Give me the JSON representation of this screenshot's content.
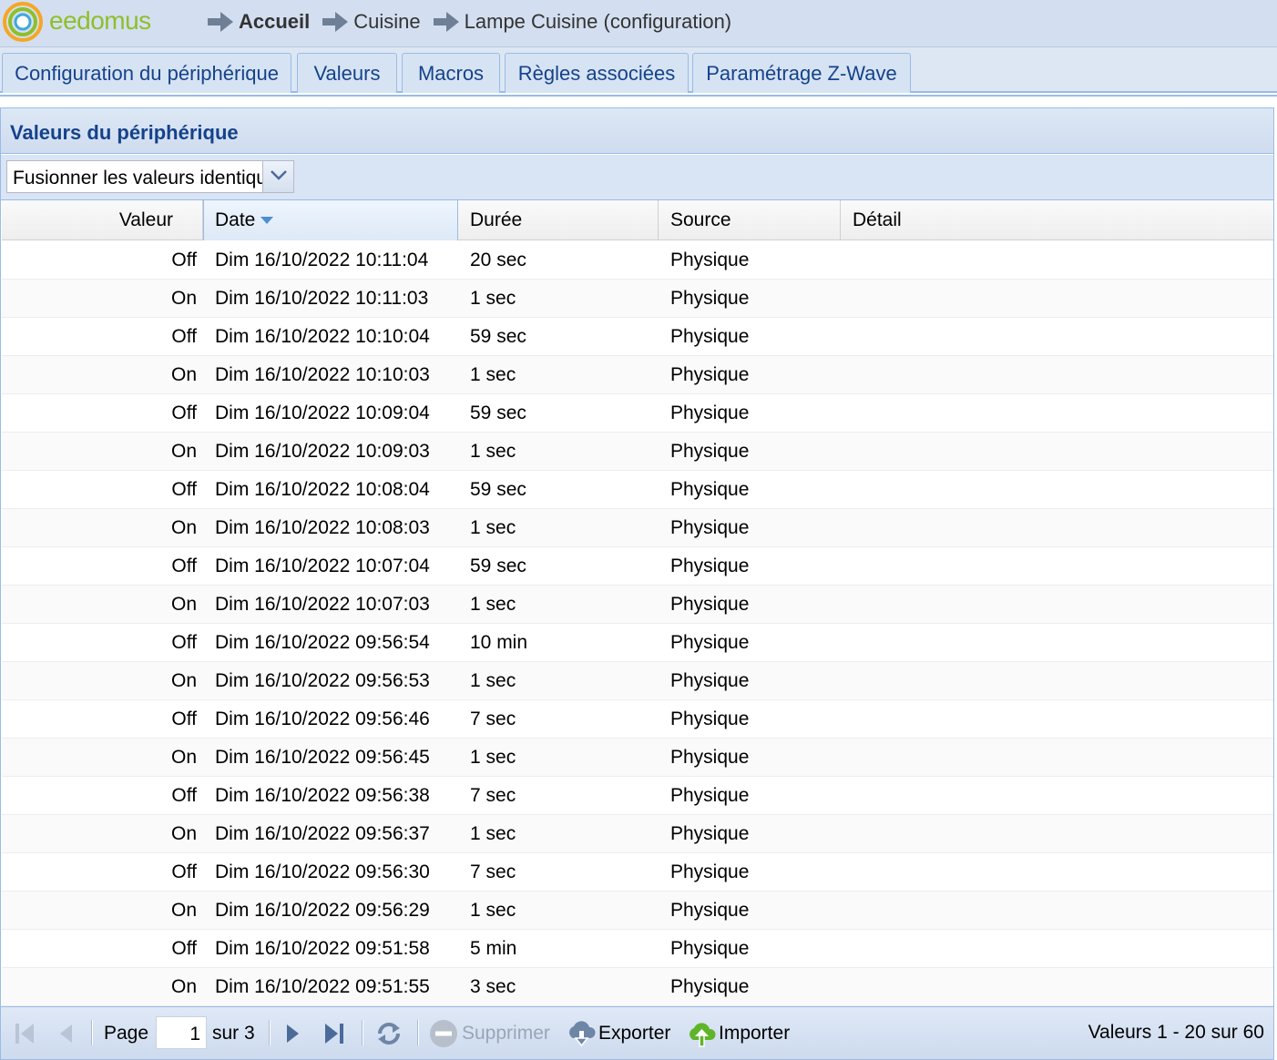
{
  "header": {
    "logo_text": "eedomus",
    "breadcrumb": [
      "Accueil",
      "Cuisine",
      "Lampe Cuisine (configuration)"
    ]
  },
  "tabs": [
    {
      "label": "Configuration du périphérique"
    },
    {
      "label": "Valeurs"
    },
    {
      "label": "Macros"
    },
    {
      "label": "Règles associées"
    },
    {
      "label": "Paramétrage Z-Wave"
    }
  ],
  "panel": {
    "title": "Valeurs du périphérique",
    "merge_combo_value": "Fusionner les valeurs identiques"
  },
  "grid": {
    "columns": [
      "Valeur",
      "Date",
      "Durée",
      "Source",
      "Détail"
    ],
    "sorted_column": "Date",
    "rows": [
      {
        "valeur": "Off",
        "date": "Dim 16/10/2022 10:11:04",
        "duree": "20 sec",
        "source": "Physique",
        "detail": ""
      },
      {
        "valeur": "On",
        "date": "Dim 16/10/2022 10:11:03",
        "duree": "1 sec",
        "source": "Physique",
        "detail": ""
      },
      {
        "valeur": "Off",
        "date": "Dim 16/10/2022 10:10:04",
        "duree": "59 sec",
        "source": "Physique",
        "detail": ""
      },
      {
        "valeur": "On",
        "date": "Dim 16/10/2022 10:10:03",
        "duree": "1 sec",
        "source": "Physique",
        "detail": ""
      },
      {
        "valeur": "Off",
        "date": "Dim 16/10/2022 10:09:04",
        "duree": "59 sec",
        "source": "Physique",
        "detail": ""
      },
      {
        "valeur": "On",
        "date": "Dim 16/10/2022 10:09:03",
        "duree": "1 sec",
        "source": "Physique",
        "detail": ""
      },
      {
        "valeur": "Off",
        "date": "Dim 16/10/2022 10:08:04",
        "duree": "59 sec",
        "source": "Physique",
        "detail": ""
      },
      {
        "valeur": "On",
        "date": "Dim 16/10/2022 10:08:03",
        "duree": "1 sec",
        "source": "Physique",
        "detail": ""
      },
      {
        "valeur": "Off",
        "date": "Dim 16/10/2022 10:07:04",
        "duree": "59 sec",
        "source": "Physique",
        "detail": ""
      },
      {
        "valeur": "On",
        "date": "Dim 16/10/2022 10:07:03",
        "duree": "1 sec",
        "source": "Physique",
        "detail": ""
      },
      {
        "valeur": "Off",
        "date": "Dim 16/10/2022 09:56:54",
        "duree": "10 min",
        "source": "Physique",
        "detail": ""
      },
      {
        "valeur": "On",
        "date": "Dim 16/10/2022 09:56:53",
        "duree": "1 sec",
        "source": "Physique",
        "detail": ""
      },
      {
        "valeur": "Off",
        "date": "Dim 16/10/2022 09:56:46",
        "duree": "7 sec",
        "source": "Physique",
        "detail": ""
      },
      {
        "valeur": "On",
        "date": "Dim 16/10/2022 09:56:45",
        "duree": "1 sec",
        "source": "Physique",
        "detail": ""
      },
      {
        "valeur": "Off",
        "date": "Dim 16/10/2022 09:56:38",
        "duree": "7 sec",
        "source": "Physique",
        "detail": ""
      },
      {
        "valeur": "On",
        "date": "Dim 16/10/2022 09:56:37",
        "duree": "1 sec",
        "source": "Physique",
        "detail": ""
      },
      {
        "valeur": "Off",
        "date": "Dim 16/10/2022 09:56:30",
        "duree": "7 sec",
        "source": "Physique",
        "detail": ""
      },
      {
        "valeur": "On",
        "date": "Dim 16/10/2022 09:56:29",
        "duree": "1 sec",
        "source": "Physique",
        "detail": ""
      },
      {
        "valeur": "Off",
        "date": "Dim 16/10/2022 09:51:58",
        "duree": "5 min",
        "source": "Physique",
        "detail": ""
      },
      {
        "valeur": "On",
        "date": "Dim 16/10/2022 09:51:55",
        "duree": "3 sec",
        "source": "Physique",
        "detail": ""
      }
    ]
  },
  "paging": {
    "page_label": "Page",
    "page_value": "1",
    "of_label": "sur 3",
    "delete_label": "Supprimer",
    "export_label": "Exporter",
    "import_label": "Importer",
    "status": "Valeurs 1 - 20 sur 60"
  },
  "colors": {
    "header_bg": "#d3dff0",
    "tab_text": "#15428b",
    "border": "#99bbe8",
    "logo_green": "#8fbf2a",
    "logo_orange": "#f5a623",
    "logo_blue": "#3fa9d8"
  },
  "icons": {
    "first": "first-page-icon",
    "prev": "prev-page-icon",
    "next": "next-page-icon",
    "last": "last-page-icon",
    "refresh": "refresh-icon",
    "delete": "delete-icon",
    "export": "cloud-download-icon",
    "import": "cloud-upload-icon"
  }
}
